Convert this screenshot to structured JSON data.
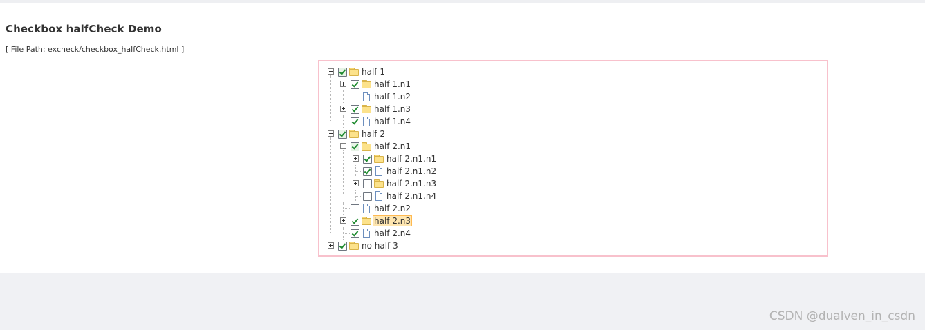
{
  "page": {
    "title": "Checkbox halfCheck Demo",
    "file_path": "[ File Path: excheck/checkbox_halfCheck.html ]"
  },
  "tree": [
    {
      "label": "half 1",
      "type": "folder",
      "level": 0,
      "switch": "minus",
      "checked": true,
      "half": true
    },
    {
      "label": "half 1.n1",
      "type": "folder",
      "level": 1,
      "switch": "plus",
      "checked": true,
      "half": false
    },
    {
      "label": "half 1.n2",
      "type": "file",
      "level": 1,
      "switch": "none",
      "checked": false,
      "half": false
    },
    {
      "label": "half 1.n3",
      "type": "folder",
      "level": 1,
      "switch": "plus",
      "checked": true,
      "half": false
    },
    {
      "label": "half 1.n4",
      "type": "file",
      "level": 1,
      "switch": "none",
      "checked": true,
      "half": false
    },
    {
      "label": "half 2",
      "type": "folder",
      "level": 0,
      "switch": "minus",
      "checked": true,
      "half": true
    },
    {
      "label": "half 2.n1",
      "type": "folder",
      "level": 1,
      "switch": "minus",
      "checked": true,
      "half": true
    },
    {
      "label": "half 2.n1.n1",
      "type": "folder",
      "level": 2,
      "switch": "plus",
      "checked": true,
      "half": false
    },
    {
      "label": "half 2.n1.n2",
      "type": "file",
      "level": 2,
      "switch": "none",
      "checked": true,
      "half": false
    },
    {
      "label": "half 2.n1.n3",
      "type": "folder",
      "level": 2,
      "switch": "plus",
      "checked": false,
      "half": false
    },
    {
      "label": "half 2.n1.n4",
      "type": "file",
      "level": 2,
      "switch": "none",
      "checked": false,
      "half": false
    },
    {
      "label": "half 2.n2",
      "type": "file",
      "level": 1,
      "switch": "none",
      "checked": false,
      "half": false
    },
    {
      "label": "half 2.n3",
      "type": "folder",
      "level": 1,
      "switch": "plus",
      "checked": true,
      "half": false,
      "selected": true
    },
    {
      "label": "half 2.n4",
      "type": "file",
      "level": 1,
      "switch": "none",
      "checked": true,
      "half": false
    },
    {
      "label": "no half 3",
      "type": "folder",
      "level": 0,
      "switch": "plus",
      "checked": true,
      "half": false
    }
  ],
  "watermark": "CSDN @dualven_in_csdn",
  "colors": {
    "tree_border": "#f8c1cc",
    "check_mark": "#1e8a2f",
    "selected_bg": "#ffe6b0",
    "folder": "#fce28b"
  }
}
